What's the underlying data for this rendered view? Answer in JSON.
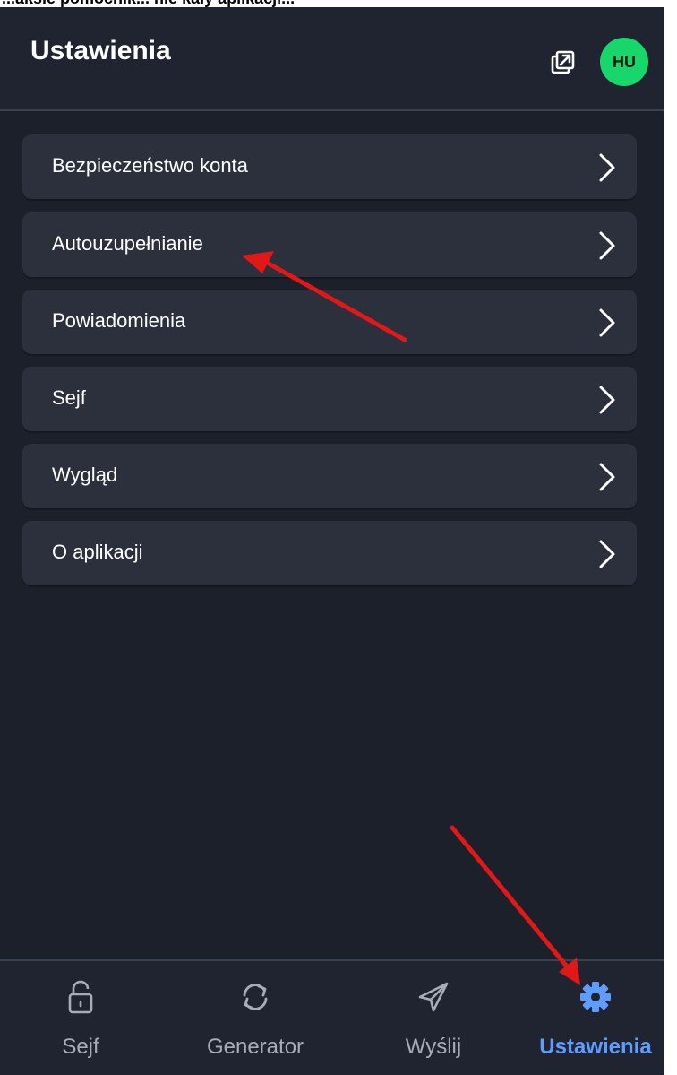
{
  "top_caption": "...aksie pomocnik... nie kaiy aplikacji...",
  "header": {
    "title": "Ustawienia",
    "avatar_initials": "HU"
  },
  "menu": [
    {
      "label": "Bezpieczeństwo konta"
    },
    {
      "label": "Autouzupełnianie"
    },
    {
      "label": "Powiadomienia"
    },
    {
      "label": "Sejf"
    },
    {
      "label": "Wygląd"
    },
    {
      "label": "O aplikacji"
    }
  ],
  "nav": [
    {
      "label": "Sejf",
      "icon": "lock-icon"
    },
    {
      "label": "Generator",
      "icon": "refresh-icon"
    },
    {
      "label": "Wyślij",
      "icon": "send-icon"
    },
    {
      "label": "Ustawienia",
      "icon": "gear-icon",
      "active": true
    }
  ],
  "colors": {
    "accent": "#5e9cff",
    "avatar": "#17d66a",
    "annotation": "#e01818",
    "background": "#1b202b"
  }
}
